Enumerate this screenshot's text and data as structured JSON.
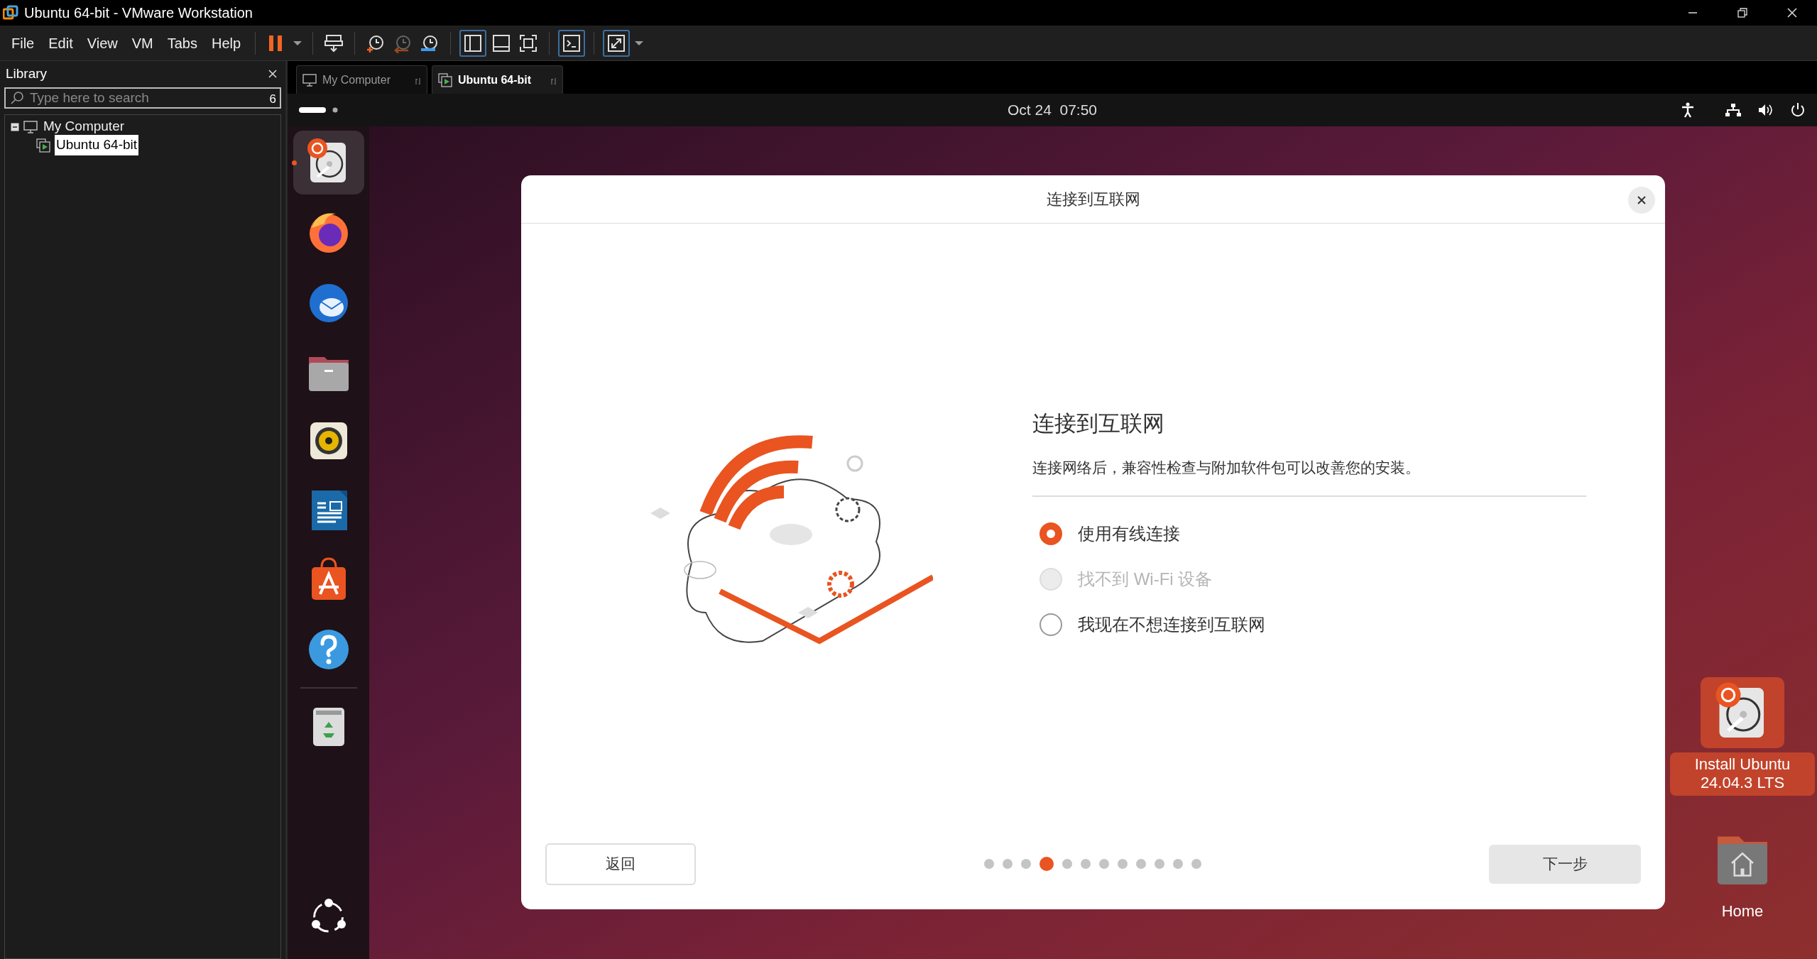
{
  "window": {
    "title": "Ubuntu 64-bit - VMware Workstation"
  },
  "menu": [
    "File",
    "Edit",
    "View",
    "VM",
    "Tabs",
    "Help"
  ],
  "library": {
    "title": "Library",
    "search": {
      "placeholder": "Type here to search",
      "count": "6"
    },
    "tree": [
      {
        "label": "My Computer",
        "expanded": true,
        "children": [
          {
            "label": "Ubuntu 64-bit",
            "selected": true
          }
        ]
      }
    ]
  },
  "tabs": [
    {
      "label": "My Computer",
      "selected": false
    },
    {
      "label": "Ubuntu 64-bit",
      "selected": true
    }
  ],
  "top_bar": {
    "clock": "Oct 24  07:50"
  },
  "dock": [
    {
      "kind": "installer",
      "running": true
    },
    {
      "kind": "firefox",
      "running": false
    },
    {
      "kind": "thunderbird",
      "running": false
    },
    {
      "kind": "files",
      "running": false
    },
    {
      "kind": "rhythmbox",
      "running": false
    },
    {
      "kind": "writer",
      "running": false
    },
    {
      "kind": "appcenter",
      "running": false
    },
    {
      "kind": "help",
      "running": false
    },
    {
      "kind": "trash",
      "running": false
    }
  ],
  "dialog": {
    "title": "连接到互联网",
    "heading": "连接到互联网",
    "description": "连接网络后，兼容性检查与附加软件包可以改善您的安装。",
    "options": [
      {
        "label": "使用有线连接",
        "selected": true,
        "disabled": false
      },
      {
        "label": "找不到 Wi-Fi 设备",
        "selected": false,
        "disabled": true
      },
      {
        "label": "我现在不想连接到互联网",
        "selected": false,
        "disabled": false
      }
    ],
    "back_button": "返回",
    "next_button": "下一步",
    "steps": [
      {
        "selected": false
      },
      {
        "selected": false
      },
      {
        "selected": false
      },
      {
        "selected": true
      },
      {
        "selected": false
      },
      {
        "selected": false
      },
      {
        "selected": false
      },
      {
        "selected": false
      },
      {
        "selected": false
      },
      {
        "selected": false
      },
      {
        "selected": false
      },
      {
        "selected": false
      }
    ]
  },
  "desktop_icons": [
    {
      "kind": "installer",
      "label": "Install Ubuntu 24.04.3 LTS",
      "selected": true
    },
    {
      "kind": "home",
      "label": "Home",
      "selected": false
    }
  ]
}
